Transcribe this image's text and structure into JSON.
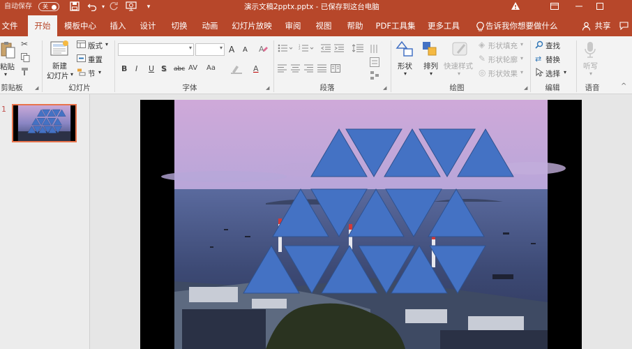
{
  "titlebar": {
    "autosave_label": "自动保存",
    "autosave_state": "关",
    "doc_title": "演示文稿2pptx.pptx  -  已保存到这台电脑",
    "save_icon": "save-icon",
    "undo_icon": "undo-icon",
    "redo_icon": "redo-icon",
    "present_icon": "present-from-start-icon",
    "customize_icon": "customize-quick-access-icon",
    "warning_icon": "warning-icon",
    "ribbon_display_icon": "ribbon-display-options-icon",
    "minimize_icon": "minimize-icon",
    "maximize_icon": "maximize-icon"
  },
  "tabs": [
    "文件",
    "开始",
    "模板中心",
    "插入",
    "设计",
    "切换",
    "动画",
    "幻灯片放映",
    "审阅",
    "视图",
    "帮助",
    "PDF工具集",
    "更多工具"
  ],
  "active_tab": "开始",
  "tell_me": "告诉我你想要做什么",
  "share": "共享",
  "ribbon": {
    "clipboard": {
      "paste": "粘贴",
      "label": "剪贴板"
    },
    "slides": {
      "new_slide": "新建",
      "new_slide_2": "幻灯片",
      "layout": "版式",
      "reset": "重置",
      "section": "节",
      "label": "幻灯片"
    },
    "font": {
      "label": "字体",
      "bold": "B",
      "italic": "I",
      "underline": "U",
      "shadow": "S",
      "strike": "abc",
      "spacing": "AV",
      "case": "Aa",
      "font_color": "A",
      "grow": "A",
      "shrink": "A"
    },
    "paragraph": {
      "label": "段落"
    },
    "drawing": {
      "shapes": "形状",
      "arrange": "排列",
      "quick_styles": "快速样式",
      "shape_fill": "形状填充",
      "shape_outline": "形状轮廓",
      "shape_effects": "形状效果",
      "label": "绘图"
    },
    "editing": {
      "find": "查找",
      "replace": "替换",
      "select": "选择",
      "label": "编辑"
    },
    "voice": {
      "dictate": "听写",
      "label": "语音"
    }
  },
  "slides_pane": {
    "slide_number": "1"
  },
  "colors": {
    "accent": "#b7472a",
    "triangle": "#4472c4",
    "ribbon_bg": "#f3f3f3"
  }
}
